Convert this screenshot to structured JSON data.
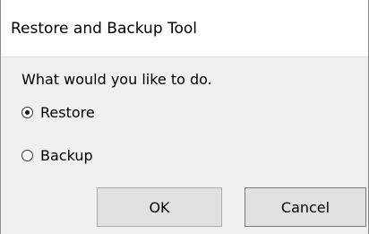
{
  "window": {
    "title": "Restore and Backup Tool"
  },
  "prompt": "What would you like to do.",
  "options": [
    {
      "label": "Restore",
      "checked": true
    },
    {
      "label": "Backup",
      "checked": false
    }
  ],
  "buttons": {
    "ok": "OK",
    "cancel": "Cancel"
  }
}
